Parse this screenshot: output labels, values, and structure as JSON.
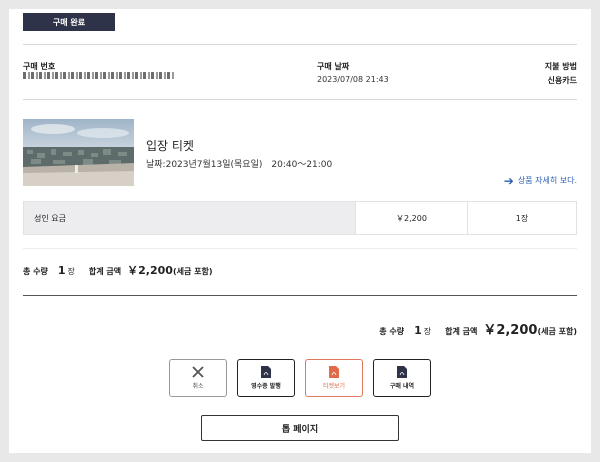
{
  "status_badge": "구매 완료",
  "purchase": {
    "number_label": "구매 번호",
    "date_label": "구매 날짜",
    "date_value": "2023/07/08 21:43",
    "payment_label": "지불 방법",
    "payment_value": "신용카드"
  },
  "ticket": {
    "title": "입장 티켓",
    "date": "날짜:2023년7월13일(목요일)　20:40～21:00",
    "detail_link": "상품 자세히 보다."
  },
  "price_row": {
    "category": "성인 요금",
    "price": "￥2,200",
    "quantity": "1장"
  },
  "summary_left": {
    "total_qty_label": "총 수량",
    "total_qty_num": "1",
    "total_qty_unit": "장",
    "total_amount_label": "합계 금액",
    "total_amount": "￥2,200",
    "tax_note": "(세금 포함)"
  },
  "summary_right": {
    "total_qty_label": "총 수량",
    "total_qty_num": "1",
    "total_qty_unit": "장",
    "total_amount_label": "합계 금액",
    "total_amount": "￥2,200",
    "tax_note": "(세금 포함)"
  },
  "actions": {
    "cancel": "취소",
    "receipt": "영수증 발행",
    "view_ticket": "티켓보기",
    "history": "구매 내역",
    "top_page": "톱 페이지"
  },
  "icons": {
    "cancel": "close-icon",
    "receipt": "pdf-icon",
    "view_ticket": "pdf-icon",
    "history": "pdf-icon",
    "detail": "arrow-right-icon"
  },
  "colors": {
    "badge_bg": "#2f3349",
    "link": "#2a5fb0",
    "ticket_accent": "#e06a4a"
  }
}
